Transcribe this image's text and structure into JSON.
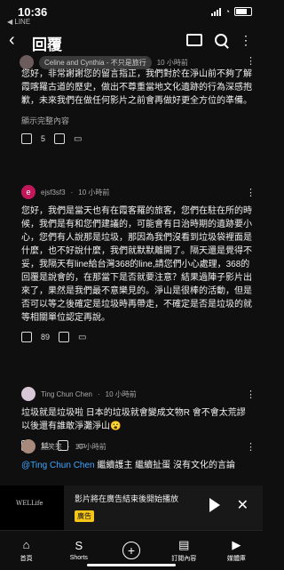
{
  "status": {
    "time": "10:36",
    "back_app": "◀ LINE"
  },
  "header": {
    "title": "回覆"
  },
  "reply_target": {
    "author_chip": "Celine and Cynthia - 不只是旅行",
    "time": "10 小時前"
  },
  "comments": [
    {
      "text": "您好，非常謝謝您的留言指正，我們對於在淨山前不夠了解霞喀羅古道的歷史，做出不尊重當地文化遺跡的行為深感抱歉，未來我們在做任何影片之前會再做好更全方位的準備。",
      "more": "顯示完整內容",
      "likes": "5"
    },
    {
      "author": "ejsf3sf3",
      "time": "10 小時前",
      "avatar_letter": "e",
      "text": "您好，我們是當天也有在霞客羅的旅客，您們在駐在所的時候，我們是有和您們建議的，可能會有日治時期的遺跡要小心，您們有人說那是垃圾，那因為我們沒看到垃圾袋裡面是什麼，也不好說什麼，我們就默默離開了。隔天還是覺得不妥，我隔天有line給台灣368的line,請您們小心處理，368的回覆是說會的，在那當下是否就要注意？結果過陣子影片出來了，果然是我們最不意樂見的。淨山是很棒的活動，但是否可以等之後確定是垃圾時再帶走，不確定是否是垃圾的就等相關單位認定再說。",
      "likes": "89"
    },
    {
      "author": "Ting Chun Chen",
      "time": "10 小時前",
      "text": "垃圾就是垃圾啦 日本的垃圾就會變成文物R 會不會太荒謬 以後還有誰敢淨灘淨山😮",
      "likes": "11"
    },
    {
      "author": "施笑笑",
      "time": "10 小時前",
      "mention": "@Ting Chun Chen",
      "text": "繼續護主 繼續扯蛋 沒有文化的言論"
    }
  ],
  "ad": {
    "thumb_text": "WELLife",
    "text": "影片將在廣告結束後開始播放",
    "badge": "廣告"
  },
  "nav": [
    {
      "label": "首頁",
      "icon": "home-icon",
      "glyph": "⌂"
    },
    {
      "label": "Shorts",
      "icon": "shorts-icon",
      "glyph": "S"
    },
    {
      "label": "",
      "icon": "create-icon",
      "glyph": "+"
    },
    {
      "label": "訂閱內容",
      "icon": "subscriptions-icon",
      "glyph": "▤"
    },
    {
      "label": "媒體庫",
      "icon": "library-icon",
      "glyph": "▶"
    }
  ]
}
